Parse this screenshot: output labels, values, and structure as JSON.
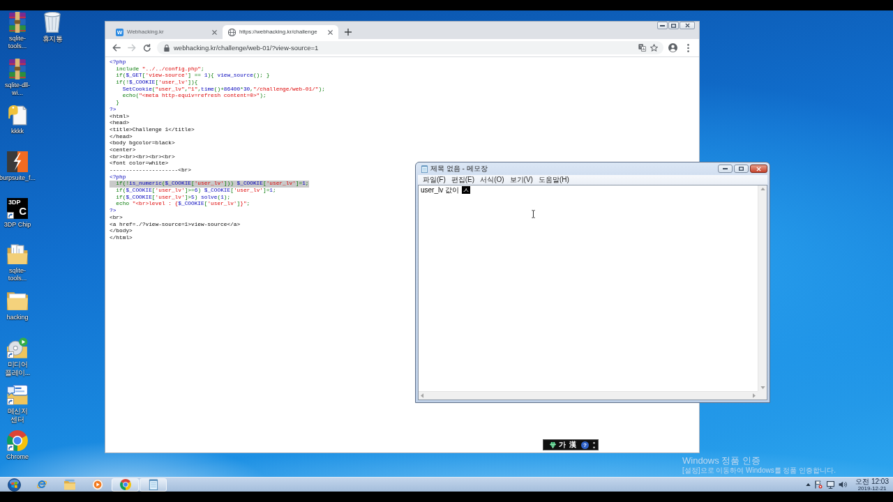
{
  "desktop_icons": [
    {
      "label": "sqlite-tools...",
      "kind": "archive",
      "shortcut": false
    },
    {
      "label": "sqlite-dll-wi...",
      "kind": "archive",
      "shortcut": false
    },
    {
      "label": "kkkk",
      "kind": "document",
      "shortcut": false
    },
    {
      "label": "burpsuite_f...",
      "kind": "bolt-tile",
      "shortcut": false
    },
    {
      "label": "3DP Chip",
      "kind": "logo-tile",
      "logo_text": [
        "3DP",
        "C"
      ],
      "shortcut": true
    },
    {
      "label": "sqlite-tools...",
      "kind": "folder-docs",
      "shortcut": false
    },
    {
      "label": "hacking",
      "kind": "folder",
      "shortcut": false
    },
    {
      "label": "미디어 플레이...",
      "kind": "media-disc",
      "shortcut": true
    },
    {
      "label": "메신저 센터",
      "kind": "messenger",
      "shortcut": true
    },
    {
      "label": "Chrome",
      "kind": "chrome",
      "shortcut": true
    },
    {
      "label": "휴지통",
      "kind": "recycle-bin",
      "shortcut": false
    }
  ],
  "browser": {
    "tabs": [
      {
        "title": "Webhacking.kr",
        "kind": "letter",
        "favicon_text": "W",
        "selected": false
      },
      {
        "title": "https://webhacking.kr/challenge",
        "kind": "globe",
        "selected": true
      }
    ],
    "nav_buttons": [
      {
        "kind": "back",
        "disabled": false
      },
      {
        "kind": "forward",
        "disabled": true
      },
      {
        "kind": "reload",
        "disabled": false
      }
    ],
    "address": "webhacking.kr/challenge/web-01/?view-source=1",
    "source_lines": [
      {
        "selected": false,
        "parts": [
          {
            "kind": "default",
            "text": "<?php"
          }
        ]
      },
      {
        "selected": false,
        "parts": [
          {
            "kind": "keyword",
            "text": "  include "
          },
          {
            "kind": "string",
            "text": "\"../../config.php\""
          },
          {
            "kind": "keyword",
            "text": ";"
          }
        ]
      },
      {
        "selected": false,
        "parts": [
          {
            "kind": "keyword",
            "text": "  if("
          },
          {
            "kind": "default",
            "text": "$_GET"
          },
          {
            "kind": "keyword",
            "text": "["
          },
          {
            "kind": "string",
            "text": "'view-source'"
          },
          {
            "kind": "keyword",
            "text": "] == "
          },
          {
            "kind": "default",
            "text": "1"
          },
          {
            "kind": "keyword",
            "text": "){ "
          },
          {
            "kind": "default",
            "text": "view_source"
          },
          {
            "kind": "keyword",
            "text": "(); }"
          }
        ]
      },
      {
        "selected": false,
        "parts": [
          {
            "kind": "keyword",
            "text": "  if(!"
          },
          {
            "kind": "default",
            "text": "$_COOKIE"
          },
          {
            "kind": "keyword",
            "text": "["
          },
          {
            "kind": "string",
            "text": "'user_lv'"
          },
          {
            "kind": "keyword",
            "text": "]){"
          }
        ]
      },
      {
        "selected": false,
        "parts": [
          {
            "kind": "default",
            "text": "    SetCookie"
          },
          {
            "kind": "keyword",
            "text": "("
          },
          {
            "kind": "string",
            "text": "\"user_lv\""
          },
          {
            "kind": "keyword",
            "text": ","
          },
          {
            "kind": "string",
            "text": "\"1\""
          },
          {
            "kind": "keyword",
            "text": ","
          },
          {
            "kind": "default",
            "text": "time"
          },
          {
            "kind": "keyword",
            "text": "()+"
          },
          {
            "kind": "default",
            "text": "86400"
          },
          {
            "kind": "keyword",
            "text": "*"
          },
          {
            "kind": "default",
            "text": "30"
          },
          {
            "kind": "keyword",
            "text": ","
          },
          {
            "kind": "string",
            "text": "\"/challenge/web-01/\""
          },
          {
            "kind": "keyword",
            "text": ");"
          }
        ]
      },
      {
        "selected": false,
        "parts": [
          {
            "kind": "keyword",
            "text": "    echo("
          },
          {
            "kind": "string",
            "text": "\"<meta http-equiv=refresh content=0>\""
          },
          {
            "kind": "keyword",
            "text": ");"
          }
        ]
      },
      {
        "selected": false,
        "parts": [
          {
            "kind": "keyword",
            "text": "  }"
          }
        ]
      },
      {
        "selected": false,
        "parts": [
          {
            "kind": "default",
            "text": "?>"
          }
        ]
      },
      {
        "selected": false,
        "parts": [
          {
            "kind": "html",
            "text": "<html>"
          }
        ]
      },
      {
        "selected": false,
        "parts": [
          {
            "kind": "html",
            "text": "<head>"
          }
        ]
      },
      {
        "selected": false,
        "parts": [
          {
            "kind": "html",
            "text": "<title>Challenge 1</title>"
          }
        ]
      },
      {
        "selected": false,
        "parts": [
          {
            "kind": "html",
            "text": "</head>"
          }
        ]
      },
      {
        "selected": false,
        "parts": [
          {
            "kind": "html",
            "text": "<body bgcolor=black>"
          }
        ]
      },
      {
        "selected": false,
        "parts": [
          {
            "kind": "html",
            "text": "<center>"
          }
        ]
      },
      {
        "selected": false,
        "parts": [
          {
            "kind": "html",
            "text": "<br><br><br><br><br>"
          }
        ]
      },
      {
        "selected": false,
        "parts": [
          {
            "kind": "html",
            "text": "<font color=white>"
          }
        ]
      },
      {
        "selected": false,
        "parts": [
          {
            "kind": "html",
            "text": "---------------------<br>"
          }
        ]
      },
      {
        "selected": false,
        "parts": [
          {
            "kind": "default",
            "text": "<?php"
          }
        ]
      },
      {
        "selected": true,
        "parts": [
          {
            "kind": "keyword",
            "text": "  if(!"
          },
          {
            "kind": "default",
            "text": "is_numeric"
          },
          {
            "kind": "keyword",
            "text": "("
          },
          {
            "kind": "default",
            "text": "$_COOKIE"
          },
          {
            "kind": "keyword",
            "text": "["
          },
          {
            "kind": "string",
            "text": "'user_lv'"
          },
          {
            "kind": "keyword",
            "text": "])) "
          },
          {
            "kind": "default",
            "text": "$_COOKIE"
          },
          {
            "kind": "keyword",
            "text": "["
          },
          {
            "kind": "string",
            "text": "'user_lv'"
          },
          {
            "kind": "keyword",
            "text": "]="
          },
          {
            "kind": "default",
            "text": "1"
          },
          {
            "kind": "keyword",
            "text": ";"
          }
        ]
      },
      {
        "selected": false,
        "parts": [
          {
            "kind": "keyword",
            "text": "  if("
          },
          {
            "kind": "default",
            "text": "$_COOKIE"
          },
          {
            "kind": "keyword",
            "text": "["
          },
          {
            "kind": "string",
            "text": "'user_lv'"
          },
          {
            "kind": "keyword",
            "text": "]>="
          },
          {
            "kind": "default",
            "text": "6"
          },
          {
            "kind": "keyword",
            "text": ") "
          },
          {
            "kind": "default",
            "text": "$_COOKIE"
          },
          {
            "kind": "keyword",
            "text": "["
          },
          {
            "kind": "string",
            "text": "'user_lv'"
          },
          {
            "kind": "keyword",
            "text": "]="
          },
          {
            "kind": "default",
            "text": "1"
          },
          {
            "kind": "keyword",
            "text": ";"
          }
        ]
      },
      {
        "selected": false,
        "parts": [
          {
            "kind": "keyword",
            "text": "  if("
          },
          {
            "kind": "default",
            "text": "$_COOKIE"
          },
          {
            "kind": "keyword",
            "text": "["
          },
          {
            "kind": "string",
            "text": "'user_lv'"
          },
          {
            "kind": "keyword",
            "text": "]>"
          },
          {
            "kind": "default",
            "text": "5"
          },
          {
            "kind": "keyword",
            "text": ") "
          },
          {
            "kind": "default",
            "text": "solve"
          },
          {
            "kind": "keyword",
            "text": "("
          },
          {
            "kind": "default",
            "text": "1"
          },
          {
            "kind": "keyword",
            "text": ");"
          }
        ]
      },
      {
        "selected": false,
        "parts": [
          {
            "kind": "keyword",
            "text": "  echo "
          },
          {
            "kind": "string",
            "text": "\"<br>level : {"
          },
          {
            "kind": "default",
            "text": "$_COOKIE"
          },
          {
            "kind": "keyword",
            "text": "["
          },
          {
            "kind": "string",
            "text": "'user_lv'"
          },
          {
            "kind": "keyword",
            "text": "]"
          },
          {
            "kind": "string",
            "text": "}\""
          },
          {
            "kind": "keyword",
            "text": ";"
          }
        ]
      },
      {
        "selected": false,
        "parts": [
          {
            "kind": "default",
            "text": "?>"
          }
        ]
      },
      {
        "selected": false,
        "parts": [
          {
            "kind": "html",
            "text": "<br>"
          }
        ]
      },
      {
        "selected": false,
        "parts": [
          {
            "kind": "html",
            "text": "<a href=./?view-source=1>view-source</a>"
          }
        ]
      },
      {
        "selected": false,
        "parts": [
          {
            "kind": "html",
            "text": "</body>"
          }
        ]
      },
      {
        "selected": false,
        "parts": [
          {
            "kind": "html",
            "text": "</html>"
          }
        ]
      }
    ]
  },
  "notepad": {
    "title": "제목 없음 - 메모장",
    "menu": [
      "파일(F)",
      "편집(E)",
      "서식(O)",
      "보기(V)",
      "도움말(H)"
    ],
    "text": "user_lv 값이",
    "composing": "ㅅ"
  },
  "ime_bar": {
    "buttons": [
      {
        "kind": "text",
        "label": "가"
      },
      {
        "kind": "text",
        "label": "漢"
      },
      {
        "kind": "help",
        "label": "?"
      }
    ]
  },
  "activation_notice": {
    "title": "Windows 정품 인증",
    "text": "[설정]으로 이동하여 Windows를 정품 인증합니다."
  },
  "taskbar": {
    "apps": [
      {
        "kind": "ie",
        "running": false
      },
      {
        "kind": "explorer",
        "running": false
      },
      {
        "kind": "media",
        "running": false
      },
      {
        "kind": "chrome",
        "running": true
      },
      {
        "kind": "notepad",
        "running": true
      }
    ],
    "clock": {
      "time": "오전 12:03",
      "date": "2019-12-21"
    }
  }
}
